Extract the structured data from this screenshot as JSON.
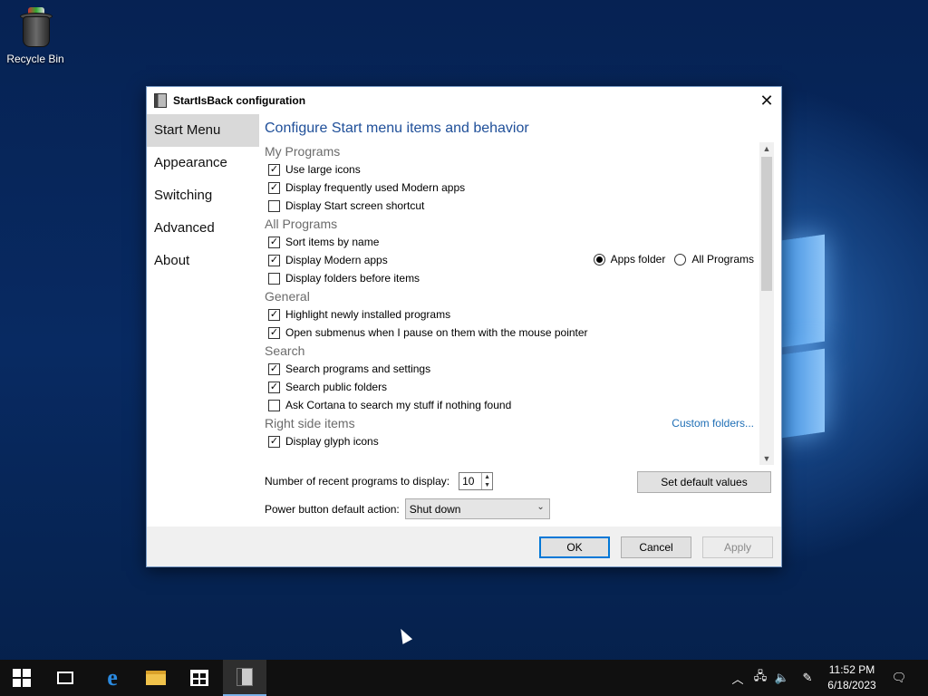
{
  "desktop": {
    "recycle_bin_label": "Recycle Bin"
  },
  "dialog": {
    "title": "StartIsBack configuration",
    "close_glyph": "✕",
    "nav": [
      {
        "label": "Start Menu",
        "active": true
      },
      {
        "label": "Appearance",
        "active": false
      },
      {
        "label": "Switching",
        "active": false
      },
      {
        "label": "Advanced",
        "active": false
      },
      {
        "label": "About",
        "active": false
      }
    ],
    "heading": "Configure Start menu items and behavior",
    "sections": {
      "my_programs": {
        "title": "My Programs",
        "items": [
          {
            "label": "Use large icons",
            "checked": true
          },
          {
            "label": "Display frequently used Modern apps",
            "checked": true
          },
          {
            "label": "Display Start screen shortcut",
            "checked": false
          }
        ]
      },
      "all_programs": {
        "title": "All Programs",
        "items": [
          {
            "label": "Sort items by name",
            "checked": true
          },
          {
            "label": "Display Modern apps",
            "checked": true
          },
          {
            "label": "Display folders before items",
            "checked": false
          }
        ],
        "radio_options": [
          {
            "label": "Apps folder",
            "selected": true
          },
          {
            "label": "All Programs",
            "selected": false
          }
        ]
      },
      "general": {
        "title": "General",
        "items": [
          {
            "label": "Highlight newly installed programs",
            "checked": true
          },
          {
            "label": "Open submenus when I pause on them with the mouse pointer",
            "checked": true
          }
        ]
      },
      "search": {
        "title": "Search",
        "items": [
          {
            "label": "Search programs and settings",
            "checked": true
          },
          {
            "label": "Search public folders",
            "checked": true
          },
          {
            "label": "Ask Cortana to search my stuff if nothing found",
            "checked": false
          }
        ]
      },
      "right_side": {
        "title": "Right side items",
        "custom_folders_link": "Custom folders...",
        "items": [
          {
            "label": "Display glyph icons",
            "checked": true
          }
        ]
      }
    },
    "recent_programs_label": "Number of recent programs to display:",
    "recent_programs_value": "10",
    "set_default_label": "Set default values",
    "power_button_label": "Power button default action:",
    "power_button_value": "Shut down",
    "buttons": {
      "ok": "OK",
      "cancel": "Cancel",
      "apply": "Apply"
    }
  },
  "taskbar": {
    "clock_time": "11:52 PM",
    "clock_date": "6/18/2023"
  },
  "colors": {
    "accent": "#0078d7",
    "heading": "#1f4f99",
    "link": "#1f6fb6",
    "taskbar": "#101010"
  }
}
